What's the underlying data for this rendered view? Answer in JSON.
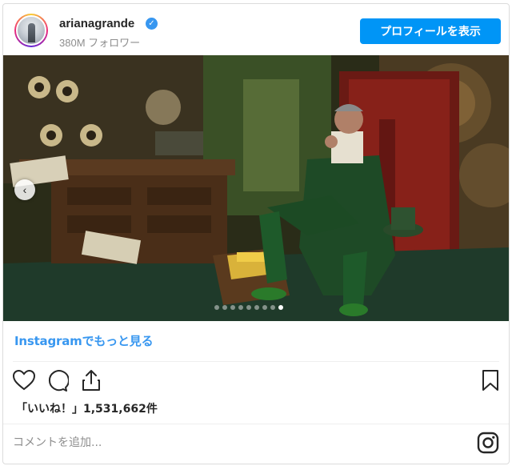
{
  "header": {
    "username": "arianagrande",
    "verified_badge": "✓",
    "followers": "380M フォロワー",
    "profile_button": "プロフィールを表示"
  },
  "photo": {
    "prev_arrow": "‹",
    "carousel_total": 9,
    "carousel_active_index": 8
  },
  "more_link": "Instagramでもっと見る",
  "actions": {
    "like_icon": "heart-icon",
    "comment_icon": "comment-icon",
    "share_icon": "share-icon",
    "save_icon": "bookmark-icon"
  },
  "likes_text": "「いいね！」1,531,662件",
  "comment": {
    "placeholder": "コメントを追加..."
  },
  "colors": {
    "accent": "#0095f6",
    "link": "#3897f0"
  }
}
